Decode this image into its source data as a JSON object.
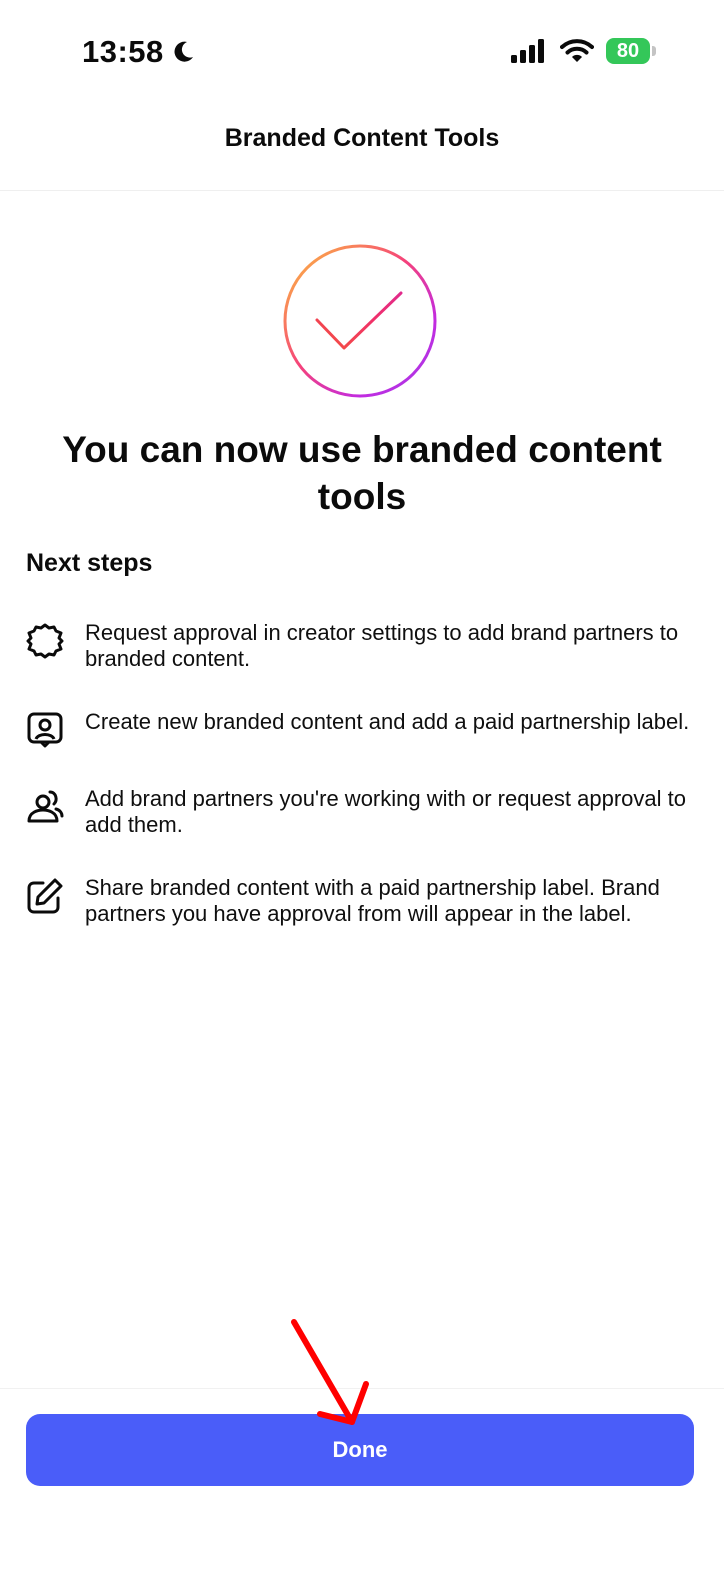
{
  "status_bar": {
    "time": "13:58",
    "battery": "80",
    "icons": [
      "moon-icon",
      "signal-icon",
      "wifi-icon",
      "battery-icon"
    ]
  },
  "header": {
    "title": "Branded Content Tools"
  },
  "hero": {
    "icon": "check-circle-icon",
    "title": "You can now use branded content tools"
  },
  "next_steps": {
    "heading": "Next steps",
    "items": [
      {
        "icon": "gear-icon",
        "text": "Request approval in creator settings to add brand partners to branded content."
      },
      {
        "icon": "profile-tag-icon",
        "text": "Create new branded content and add a paid partnership label."
      },
      {
        "icon": "people-icon",
        "text": "Add brand partners you're working with or request approval to add them."
      },
      {
        "icon": "edit-icon",
        "text": "Share branded content with a paid partnership label. Brand partners you have approval from will appear in the label."
      }
    ]
  },
  "footer": {
    "done_label": "Done"
  },
  "colors": {
    "accent": "#4a5df9",
    "battery": "#34c759",
    "annotation": "#ff0000",
    "gradient": [
      "#fcc33b",
      "#f5427a",
      "#c22be0",
      "#a33ce8"
    ]
  }
}
